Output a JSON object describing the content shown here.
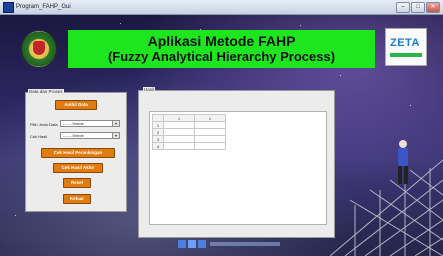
{
  "window": {
    "title": "Program_FAHP_Gui",
    "buttons": {
      "minimize": "–",
      "maximize": "□",
      "close": "✕"
    }
  },
  "header": {
    "title": "Aplikasi Metode FAHP",
    "subtitle": "(Fuzzy Analytical Hierarchy Process)",
    "banner_color": "#1ee61e",
    "right_logo_text": "ZETA"
  },
  "left_panel": {
    "label": "Data dan Proses",
    "ambil_data": "Ambil Data",
    "pilih_jenis_label": "Pilih Jenis Data",
    "pilih_jenis_value": "--------Selecte",
    "cek_hasil_label": "Cek Hasil",
    "cek_hasil_value": "--------Selecte",
    "cek_perankingan": "Cek Hasil Perankingan",
    "cek_akhir": "Cek Hasil Akhir",
    "reset": "Reset",
    "keluar": "Keluar",
    "button_color": "#e07b10"
  },
  "right_panel": {
    "label": "Hasil",
    "table": {
      "columns": [
        "1",
        "2"
      ],
      "rows": [
        "1",
        "2",
        "3",
        "4"
      ]
    }
  }
}
